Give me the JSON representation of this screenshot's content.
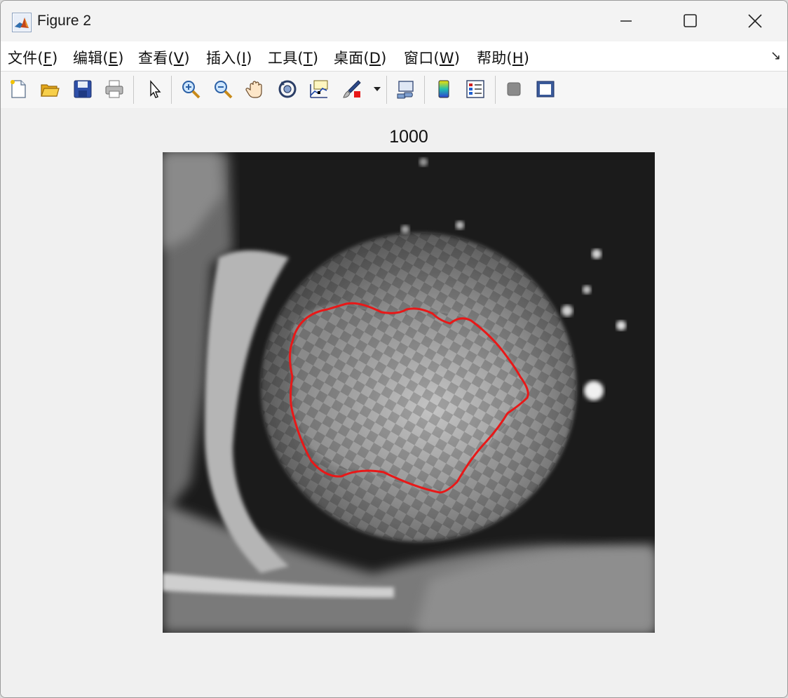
{
  "window": {
    "title": "Figure 2"
  },
  "menu": [
    {
      "label": "文件(",
      "key": "F",
      "end": ")"
    },
    {
      "label": "编辑(",
      "key": "E",
      "end": ")"
    },
    {
      "label": "查看(",
      "key": "V",
      "end": ")"
    },
    {
      "label": "插入(",
      "key": "I",
      "end": ")"
    },
    {
      "label": "工具(",
      "key": "T",
      "end": ")"
    },
    {
      "label": "桌面(",
      "key": "D",
      "end": ")"
    },
    {
      "label": "窗口(",
      "key": "W",
      "end": ")"
    },
    {
      "label": "帮助(",
      "key": "H",
      "end": ")"
    }
  ],
  "toolbar": {
    "icons": [
      "new-figure-icon",
      "open-file-icon",
      "save-icon",
      "print-icon",
      "pointer-icon",
      "zoom-in-icon",
      "zoom-out-icon",
      "pan-hand-icon",
      "rotate-3d-icon",
      "data-cursor-icon",
      "brush-icon",
      "brush-dropdown-icon",
      "link-plot-icon",
      "colorbar-icon",
      "legend-icon",
      "hide-plot-tools-icon",
      "show-plot-tools-icon"
    ]
  },
  "axes": {
    "title": "1000"
  },
  "overlay": {
    "contour_color": "#e81818"
  }
}
